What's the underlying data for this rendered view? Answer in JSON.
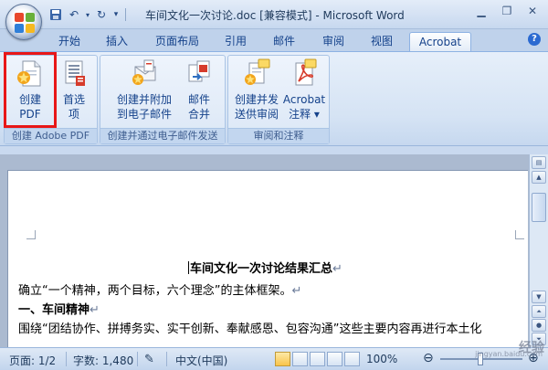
{
  "title_bar": {
    "title": "车间文化一次讨论.doc [兼容模式] - Microsoft Word",
    "qat_icons": [
      "save-icon",
      "undo-icon",
      "redo-icon",
      "customize-icon"
    ],
    "window_controls": [
      "minimize-icon",
      "restore-icon",
      "close-icon"
    ]
  },
  "tabs": [
    {
      "label": "开始"
    },
    {
      "label": "插入"
    },
    {
      "label": "页面布局"
    },
    {
      "label": "引用"
    },
    {
      "label": "邮件"
    },
    {
      "label": "审阅"
    },
    {
      "label": "视图"
    },
    {
      "label": "Acrobat"
    }
  ],
  "active_tab": "Acrobat",
  "ribbon": {
    "groups": [
      {
        "label": "创建 Adobe PDF",
        "buttons": [
          {
            "line1": "创建",
            "line2": "PDF",
            "icon": "create-pdf-icon"
          },
          {
            "line1": "首选",
            "line2": "项",
            "icon": "preferences-icon"
          }
        ]
      },
      {
        "label": "创建并通过电子邮件发送",
        "buttons": [
          {
            "line1": "创建并附加",
            "line2": "到电子邮件",
            "icon": "create-attach-email-icon"
          },
          {
            "line1": "邮件",
            "line2": "合并",
            "icon": "mail-merge-icon"
          }
        ]
      },
      {
        "label": "审阅和注释",
        "buttons": [
          {
            "line1": "创建并发",
            "line2": "送供审阅",
            "icon": "send-review-icon"
          },
          {
            "line1": "Acrobat",
            "line2": "注释 ▾",
            "icon": "acrobat-comments-icon"
          }
        ]
      }
    ]
  },
  "document": {
    "title": "车间文化一次讨论结果汇总",
    "lines": [
      "确立“一个精神，两个目标，六个理念”的主体框架。",
      "一、车间精神",
      "围绕“团结协作、拼搏务实、实干创新、奉献感恩、包容沟通”这些主要内容再进行本土化"
    ],
    "para_mark": "↵"
  },
  "status_bar": {
    "page": "页面: 1/2",
    "word_count": "字数: 1,480",
    "language": "中文(中国)",
    "zoom": "100%",
    "zoom_level_percent": 100
  },
  "watermark": {
    "text": "经验",
    "url": "jingyan.baidu.com"
  },
  "colors": {
    "highlight_box": "#e81717",
    "ribbon_text": "#15428b",
    "frame": "#c9d9ef"
  }
}
